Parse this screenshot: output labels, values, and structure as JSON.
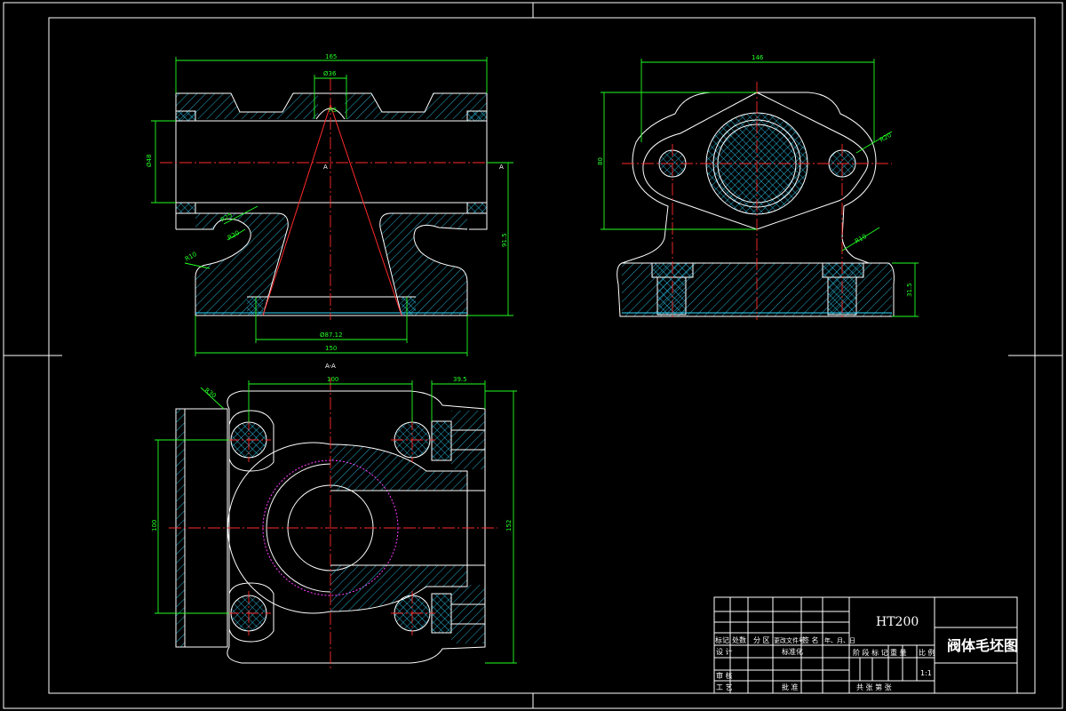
{
  "drawing": {
    "title": "阀体毛坯图",
    "material": "HT200",
    "scale": "1:1",
    "section_label": "A-A",
    "section_marker": "A"
  },
  "dimensions": {
    "front_top_width": "165",
    "front_top_bore": "Ø36",
    "front_left_height": "Ø48",
    "front_right_height": "91.5",
    "front_bottom_bore": "Ø87.12",
    "front_bottom_width": "150",
    "front_radius_1": "R25",
    "front_radius_2": "R20",
    "front_radius_3": "R10",
    "front_radius_4": "R5",
    "side_top_width": "146",
    "side_left_height": "80",
    "side_radius_top": "R20",
    "side_radius_bottom": "R10",
    "side_base_height": "31.5",
    "plan_top_width": "100",
    "plan_right_top": "39.5",
    "plan_left_height": "100",
    "plan_right_height": "152",
    "plan_radius": "R30"
  },
  "title_block": {
    "row_labels_left": [
      "标记",
      "处数",
      "分 区",
      "更改文件号",
      "签 名",
      "年、月、日"
    ],
    "design": "设 计",
    "standardize": "标准化",
    "review": "审 核",
    "process": "工 艺",
    "approve": "批 准",
    "stage_mark": "阶 段 标 记",
    "weight": "重 量",
    "ratio": "比 例",
    "sheets": "共    张  第    张"
  }
}
